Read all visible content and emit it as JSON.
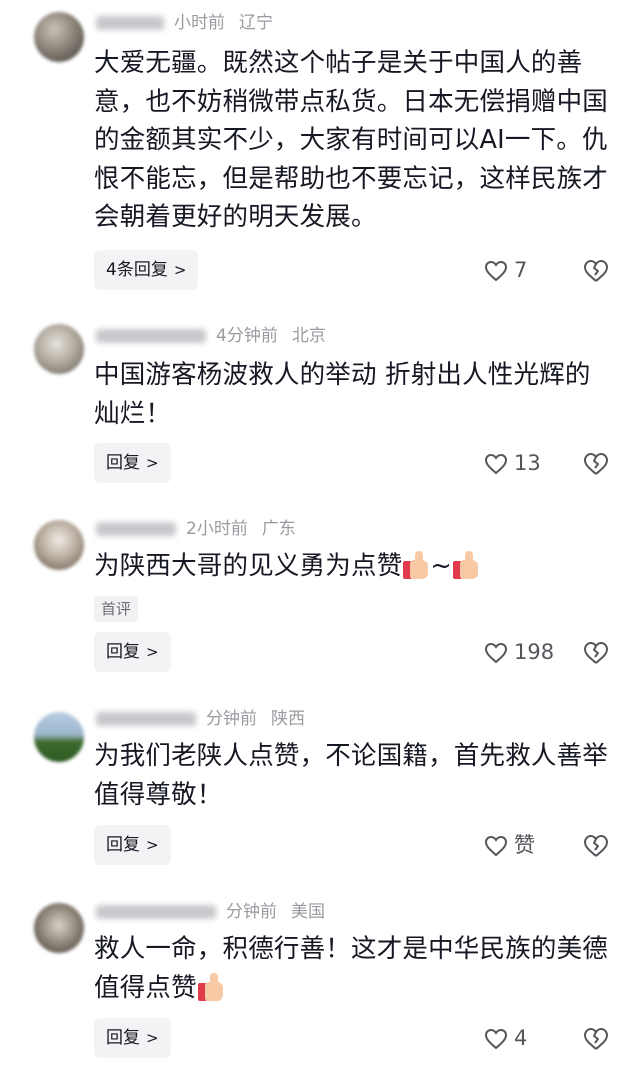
{
  "comments": [
    {
      "time": "小时前",
      "location": "辽宁",
      "text": "大爱无疆。既然这个帖子是关于中国人的善意，也不妨稍微带点私货。日本无偿捐赠中国的金额其实不少，大家有时间可以AI一下。仇恨不能忘，但是帮助也不要忘记，这样民族才会朝着更好的明天发展。",
      "reply_label": "4条回复",
      "likes": "7"
    },
    {
      "time": "4分钟前",
      "location": "北京",
      "text": "中国游客杨波救人的举动 折射出人性光辉的灿烂！",
      "reply_label": "回复",
      "likes": "13"
    },
    {
      "time": "2小时前",
      "location": "广东",
      "text": "为陕西大哥的见义勇为点赞",
      "text_tail": "~",
      "badge": "首评",
      "reply_label": "回复",
      "likes": "198"
    },
    {
      "time": "分钟前",
      "location": "陕西",
      "text": "为我们老陕人点赞，不论国籍，首先救人善举值得尊敬！",
      "reply_label": "回复",
      "likes": "赞"
    },
    {
      "time": "分钟前",
      "location": "美国",
      "text": "救人一命，积德行善！这才是中华民族的美德值得点赞",
      "reply_label": "回复",
      "likes": "4"
    }
  ],
  "icons": {
    "like": "heart-outline-icon",
    "dislike": "broken-heart-icon",
    "reply_chevron": "chevron-right-icon",
    "emoji": "thumbs-up-emoji"
  },
  "colors": {
    "text": "#161823",
    "meta": "#9a9ba0",
    "button_bg": "#f3f3f5"
  }
}
